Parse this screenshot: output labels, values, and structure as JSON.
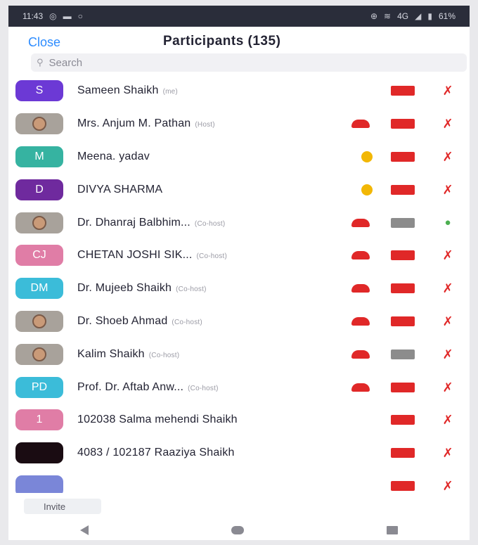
{
  "status_bar": {
    "time": "11:43",
    "left_icons": [
      "messenger-icon",
      "video-icon",
      "circle-icon"
    ],
    "network": "4G",
    "battery": "61%"
  },
  "header": {
    "close_label": "Close",
    "title": "Participants (135)"
  },
  "search": {
    "placeholder": "Search"
  },
  "participants": [
    {
      "avatar": "S",
      "avatar_color": "#6c39d5",
      "name": "Sameen Shaikh",
      "role": "(me)",
      "cloud": false,
      "hand": false,
      "video": "off",
      "mic": "off"
    },
    {
      "avatar": "",
      "avatar_color": "photo",
      "name": "Mrs. Anjum M. Pathan",
      "role": "(Host)",
      "cloud": true,
      "hand": false,
      "video": "off",
      "mic": "off"
    },
    {
      "avatar": "M",
      "avatar_color": "#36b3a1",
      "name": "Meena. yadav",
      "role": "",
      "cloud": false,
      "hand": true,
      "video": "off",
      "mic": "off"
    },
    {
      "avatar": "D",
      "avatar_color": "#6f2a9e",
      "name": "DIVYA SHARMA",
      "role": "",
      "cloud": false,
      "hand": true,
      "video": "off",
      "mic": "off"
    },
    {
      "avatar": "",
      "avatar_color": "photo",
      "name": "Dr. Dhanraj Balbhim...",
      "role": "(Co-host)",
      "cloud": true,
      "hand": false,
      "video": "on",
      "mic": "on"
    },
    {
      "avatar": "CJ",
      "avatar_color": "#e07da6",
      "name": "CHETAN JOSHI SIK...",
      "role": "(Co-host)",
      "cloud": true,
      "hand": false,
      "video": "off",
      "mic": "off"
    },
    {
      "avatar": "DM",
      "avatar_color": "#3bbcd9",
      "name": "Dr. Mujeeb Shaikh",
      "role": "(Co-host)",
      "cloud": true,
      "hand": false,
      "video": "off",
      "mic": "off"
    },
    {
      "avatar": "",
      "avatar_color": "photo",
      "name": "Dr. Shoeb Ahmad",
      "role": "(Co-host)",
      "cloud": true,
      "hand": false,
      "video": "off",
      "mic": "off"
    },
    {
      "avatar": "",
      "avatar_color": "photo",
      "name": "Kalim Shaikh",
      "role": "(Co-host)",
      "cloud": true,
      "hand": false,
      "video": "on",
      "mic": "off"
    },
    {
      "avatar": "PD",
      "avatar_color": "#3bbcd9",
      "name": "Prof. Dr. Aftab Anw...",
      "role": "(Co-host)",
      "cloud": true,
      "hand": false,
      "video": "off",
      "mic": "off"
    },
    {
      "avatar": "1",
      "avatar_color": "#e07da6",
      "name": "102038 Salma mehendi Shaikh",
      "role": "",
      "cloud": false,
      "hand": false,
      "video": "off",
      "mic": "off"
    },
    {
      "avatar": "",
      "avatar_color": "#1a0c12",
      "name": "4083 / 102187 Raaziya Shaikh",
      "role": "",
      "cloud": false,
      "hand": false,
      "video": "off",
      "mic": "off"
    },
    {
      "avatar": "",
      "avatar_color": "#7a86d8",
      "name": "",
      "role": "",
      "cloud": false,
      "hand": false,
      "video": "off",
      "mic": "off"
    }
  ],
  "footer": {
    "invite_label": "Invite"
  },
  "colors": {
    "accent": "#2d8cff",
    "muted_red": "#e02828",
    "hand_yellow": "#f2b705"
  }
}
